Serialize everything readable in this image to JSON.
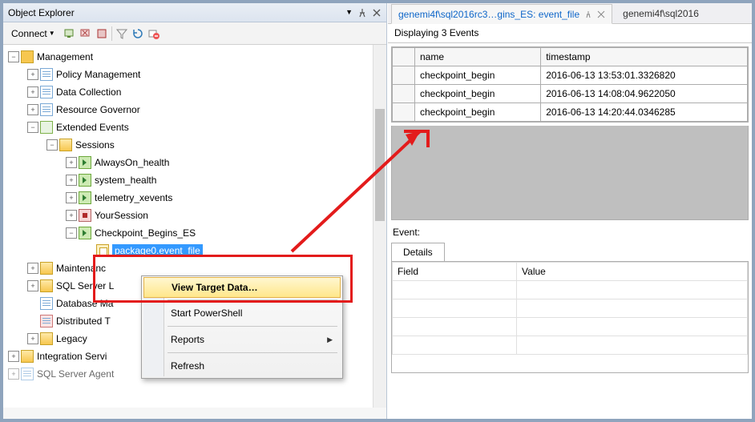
{
  "objectExplorer": {
    "title": "Object Explorer",
    "connectLabel": "Connect",
    "tree": {
      "root": "Management",
      "children": [
        {
          "label": "Policy Management",
          "icon": "leafdoc",
          "expand": "+"
        },
        {
          "label": "Data Collection",
          "icon": "leafdoc",
          "expand": "+"
        },
        {
          "label": "Resource Governor",
          "icon": "leafdoc",
          "expand": "+"
        },
        {
          "label": "Extended Events",
          "icon": "xe",
          "expand": "−",
          "children": [
            {
              "label": "Sessions",
              "icon": "folder",
              "expand": "−",
              "children": [
                {
                  "label": "AlwaysOn_health",
                  "icon": "sess-start",
                  "expand": "+"
                },
                {
                  "label": "system_health",
                  "icon": "sess-start",
                  "expand": "+"
                },
                {
                  "label": "telemetry_xevents",
                  "icon": "sess-start",
                  "expand": "+"
                },
                {
                  "label": "YourSession",
                  "icon": "sess-stop",
                  "expand": "+"
                },
                {
                  "label": "Checkpoint_Begins_ES",
                  "icon": "sess-start",
                  "expand": "−",
                  "children": [
                    {
                      "label": "package0.event_file",
                      "icon": "target",
                      "selected": true
                    }
                  ]
                }
              ]
            }
          ]
        },
        {
          "label": "Maintenanc",
          "icon": "folder",
          "expand": "+",
          "truncated": true
        },
        {
          "label": "SQL Server L",
          "icon": "folder",
          "expand": "+",
          "truncated": true
        },
        {
          "label": "Database Ma",
          "icon": "leafdoc",
          "truncated": true
        },
        {
          "label": "Distributed T",
          "icon": "leafdoc",
          "truncated": true
        },
        {
          "label": "Legacy",
          "icon": "folder",
          "expand": "+"
        }
      ],
      "after": [
        {
          "label": "Integration Servi",
          "icon": "folder",
          "expand": "+",
          "truncated": true
        },
        {
          "label": "SQL Server Agent",
          "icon": "leafdoc",
          "expand": "+",
          "truncated": true,
          "faded": true
        }
      ]
    }
  },
  "contextMenu": {
    "items": [
      {
        "label": "View Target Data…",
        "highlight": true
      },
      {
        "label": "Start PowerShell"
      },
      {
        "label": "Reports",
        "hasSub": true
      },
      {
        "label": "Refresh"
      }
    ]
  },
  "eventsPane": {
    "tabs": [
      {
        "label": "genemi4f\\sql2016rc3…gins_ES: event_file",
        "active": true,
        "pinned": true
      },
      {
        "label": "genemi4f\\sql2016",
        "active": false
      }
    ],
    "displaying": "Displaying 3 Events",
    "grid": {
      "columns": [
        "name",
        "timestamp"
      ],
      "rows": [
        {
          "name": "checkpoint_begin",
          "timestamp": "2016-06-13 13:53:01.3326820"
        },
        {
          "name": "checkpoint_begin",
          "timestamp": "2016-06-13 14:08:04.9622050"
        },
        {
          "name": "checkpoint_begin",
          "timestamp": "2016-06-13 14:20:44.0346285"
        }
      ]
    },
    "eventLabel": "Event:",
    "detailTab": "Details",
    "detailColumns": [
      "Field",
      "Value"
    ]
  }
}
